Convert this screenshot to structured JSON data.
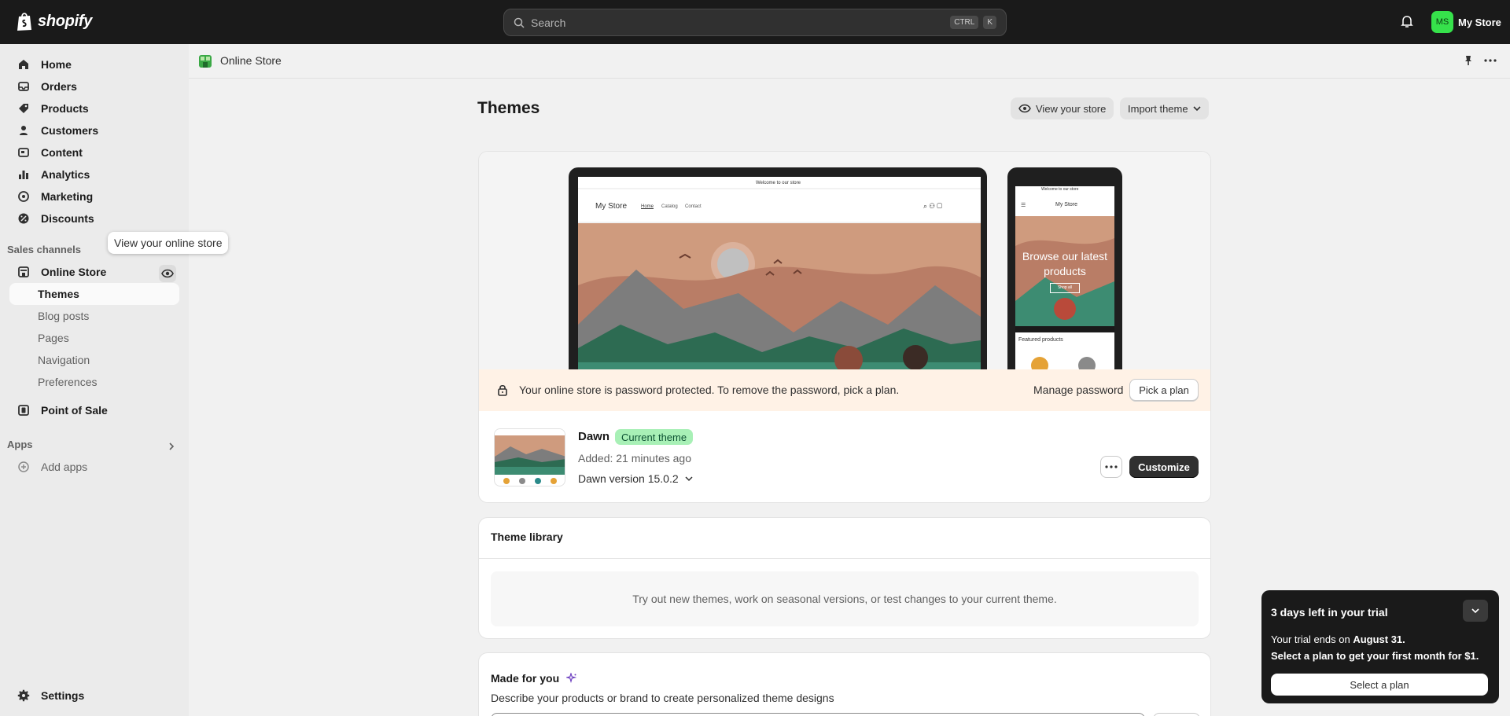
{
  "topbar": {
    "brand": "shopify",
    "search_placeholder": "Search",
    "shortcut_ctrl": "CTRL",
    "shortcut_k": "K",
    "user_initials": "MS",
    "user_name": "My Store"
  },
  "sidebar": {
    "items": [
      {
        "label": "Home",
        "icon": "home-icon"
      },
      {
        "label": "Orders",
        "icon": "orders-icon"
      },
      {
        "label": "Products",
        "icon": "tag-icon"
      },
      {
        "label": "Customers",
        "icon": "person-icon"
      },
      {
        "label": "Content",
        "icon": "content-icon"
      },
      {
        "label": "Analytics",
        "icon": "chart-icon"
      },
      {
        "label": "Marketing",
        "icon": "target-icon"
      },
      {
        "label": "Discounts",
        "icon": "discount-icon"
      }
    ],
    "sales_channels_label": "Sales channels",
    "online_store": "Online Store",
    "online_store_sub": [
      "Themes",
      "Blog posts",
      "Pages",
      "Navigation",
      "Preferences"
    ],
    "point_of_sale": "Point of Sale",
    "apps_label": "Apps",
    "add_apps": "Add apps",
    "settings": "Settings",
    "tooltip": "View your online store"
  },
  "header": {
    "breadcrumb": "Online Store"
  },
  "main": {
    "title": "Themes",
    "view_store": "View your store",
    "import_theme": "Import theme",
    "preview": {
      "desktop_announcement": "Welcome to our store",
      "desktop_logo": "My Store",
      "desktop_nav": [
        "Home",
        "Catalog",
        "Contact"
      ],
      "mobile_announcement": "Welcome to our store",
      "mobile_logo": "My Store",
      "mobile_hero": "Browse our latest products",
      "mobile_hero_button": "Shop all",
      "mobile_featured": "Featured products"
    },
    "banner_text": "Your online store is password protected. To remove the password, pick a plan.",
    "manage_password": "Manage password",
    "pick_plan": "Pick a plan",
    "theme": {
      "name": "Dawn",
      "badge": "Current theme",
      "added": "Added: 21 minutes ago",
      "version": "Dawn version 15.0.2",
      "customize": "Customize"
    },
    "library": {
      "title": "Theme library",
      "empty_text": "Try out new themes, work on seasonal versions, or test changes to your current theme."
    },
    "made_for_you": {
      "title": "Made for you",
      "subtitle": "Describe your products or brand to create personalized theme designs"
    }
  },
  "trial": {
    "title": "3 days left in your trial",
    "line1_prefix": "Your trial ends on ",
    "line1_date": "August 31.",
    "line2": "Select a plan to get your first month for $1.",
    "button": "Select a plan"
  },
  "colors": {
    "topbar": "#1a1a1a",
    "accent_green": "#36e14b",
    "banner_bg": "#fff2e6",
    "badge_bg": "#a8f0b6"
  }
}
